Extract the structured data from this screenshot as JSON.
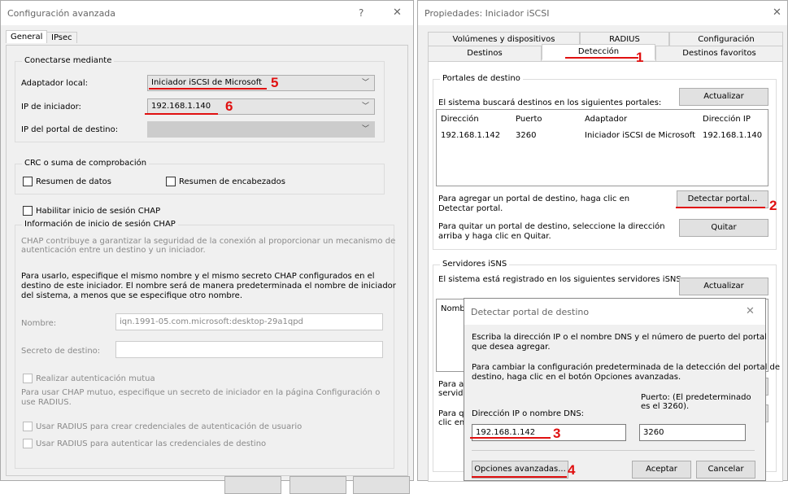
{
  "left": {
    "title": "Configuración avanzada",
    "help": "?",
    "close": "✕",
    "tabs": [
      "General",
      "IPsec"
    ],
    "connect_group": "Conectarse mediante",
    "adapter_label": "Adaptador local:",
    "adapter_value": "Iniciador iSCSI de Microsoft",
    "initiator_ip_label": "IP de iniciador:",
    "initiator_ip_value": "192.168.1.140",
    "target_portal_ip_label": "IP del portal de destino:",
    "crc_group": "CRC o suma de comprobación",
    "data_digest": "Resumen de datos",
    "header_digest": "Resumen de encabezados",
    "chap_enable": "Habilitar inicio de sesión CHAP",
    "chap_group": "Información de inicio de sesión CHAP",
    "chap_desc1": "CHAP contribuye a garantizar la seguridad de la conexión al proporcionar un mecanismo de",
    "chap_desc2": "autenticación entre un destino y un iniciador.",
    "usage1": "Para usarlo, especifique el mismo nombre y el mismo secreto CHAP configurados en el",
    "usage2": "destino de este iniciador. El nombre será de manera predeterminada el nombre de iniciador",
    "usage3": "del sistema, a menos que se especifique otro nombre.",
    "name_label": "Nombre:",
    "name_value": "iqn.1991-05.com.microsoft:desktop-29a1qpd",
    "secret_label": "Secreto de destino:",
    "mutual": "Realizar autenticación mutua",
    "mutual_desc1": "Para usar CHAP mutuo, especifique un secreto de iniciador en la página Configuración o",
    "mutual_desc2": "use RADIUS.",
    "radius1": "Usar RADIUS para crear credenciales de autenticación de usuario",
    "radius2": "Usar RADIUS para autenticar las credenciales de destino"
  },
  "right": {
    "title": "Propiedades: Iniciador iSCSI",
    "close": "✕",
    "tabs_top": [
      "Volúmenes y dispositivos",
      "RADIUS",
      "Configuración"
    ],
    "tabs_bottom": [
      "Destinos",
      "Detección",
      "Destinos favoritos"
    ],
    "portals_group": "Portales de destino",
    "portals_desc": "El sistema buscará destinos en los siguientes portales:",
    "refresh": "Actualizar",
    "columns": [
      "Dirección",
      "Puerto",
      "Adaptador",
      "Dirección IP"
    ],
    "rows": [
      [
        "192.168.1.142",
        "3260",
        "Iniciador iSCSI de Microsoft",
        "192.168.1.140"
      ]
    ],
    "add_desc1": "Para agregar un portal de destino, haga clic en",
    "add_desc2": "Detectar portal.",
    "detect_portal": "Detectar portal...",
    "remove_desc1": "Para quitar un portal de destino, seleccione la dirección",
    "remove_desc2": "arriba y haga clic en Quitar.",
    "remove": "Quitar",
    "isns_group": "Servidores iSNS",
    "isns_desc": "El sistema está registrado en los siguientes servidores iSNS:",
    "isns_refresh": "Actualizar",
    "isns_col": "Nomb",
    "frag1a": "Para a",
    "frag1b": "servido",
    "frag2a": "Para q",
    "frag2b": "clic en"
  },
  "dialog": {
    "title": "Detectar portal de destino",
    "close": "✕",
    "desc1": "Escriba la dirección IP o el nombre DNS y el número de puerto del portal",
    "desc2": "que desea agregar.",
    "desc3": "Para cambiar la configuración predeterminada de la detección del portal de",
    "desc4": "destino, haga clic en el botón Opciones avanzadas.",
    "ip_label": "Dirección IP o nombre DNS:",
    "port_label1": "Puerto: (El predeterminado",
    "port_label2": "es el 3260).",
    "ip_value": "192.168.1.142",
    "port_value": "3260",
    "advanced": "Opciones avanzadas...",
    "accept": "Aceptar",
    "cancel": "Cancelar"
  },
  "annotations": [
    "1",
    "2",
    "3",
    "4",
    "5",
    "6"
  ],
  "colors": {
    "annotation": "#e01010",
    "window_bg": "#f0f0f0"
  }
}
